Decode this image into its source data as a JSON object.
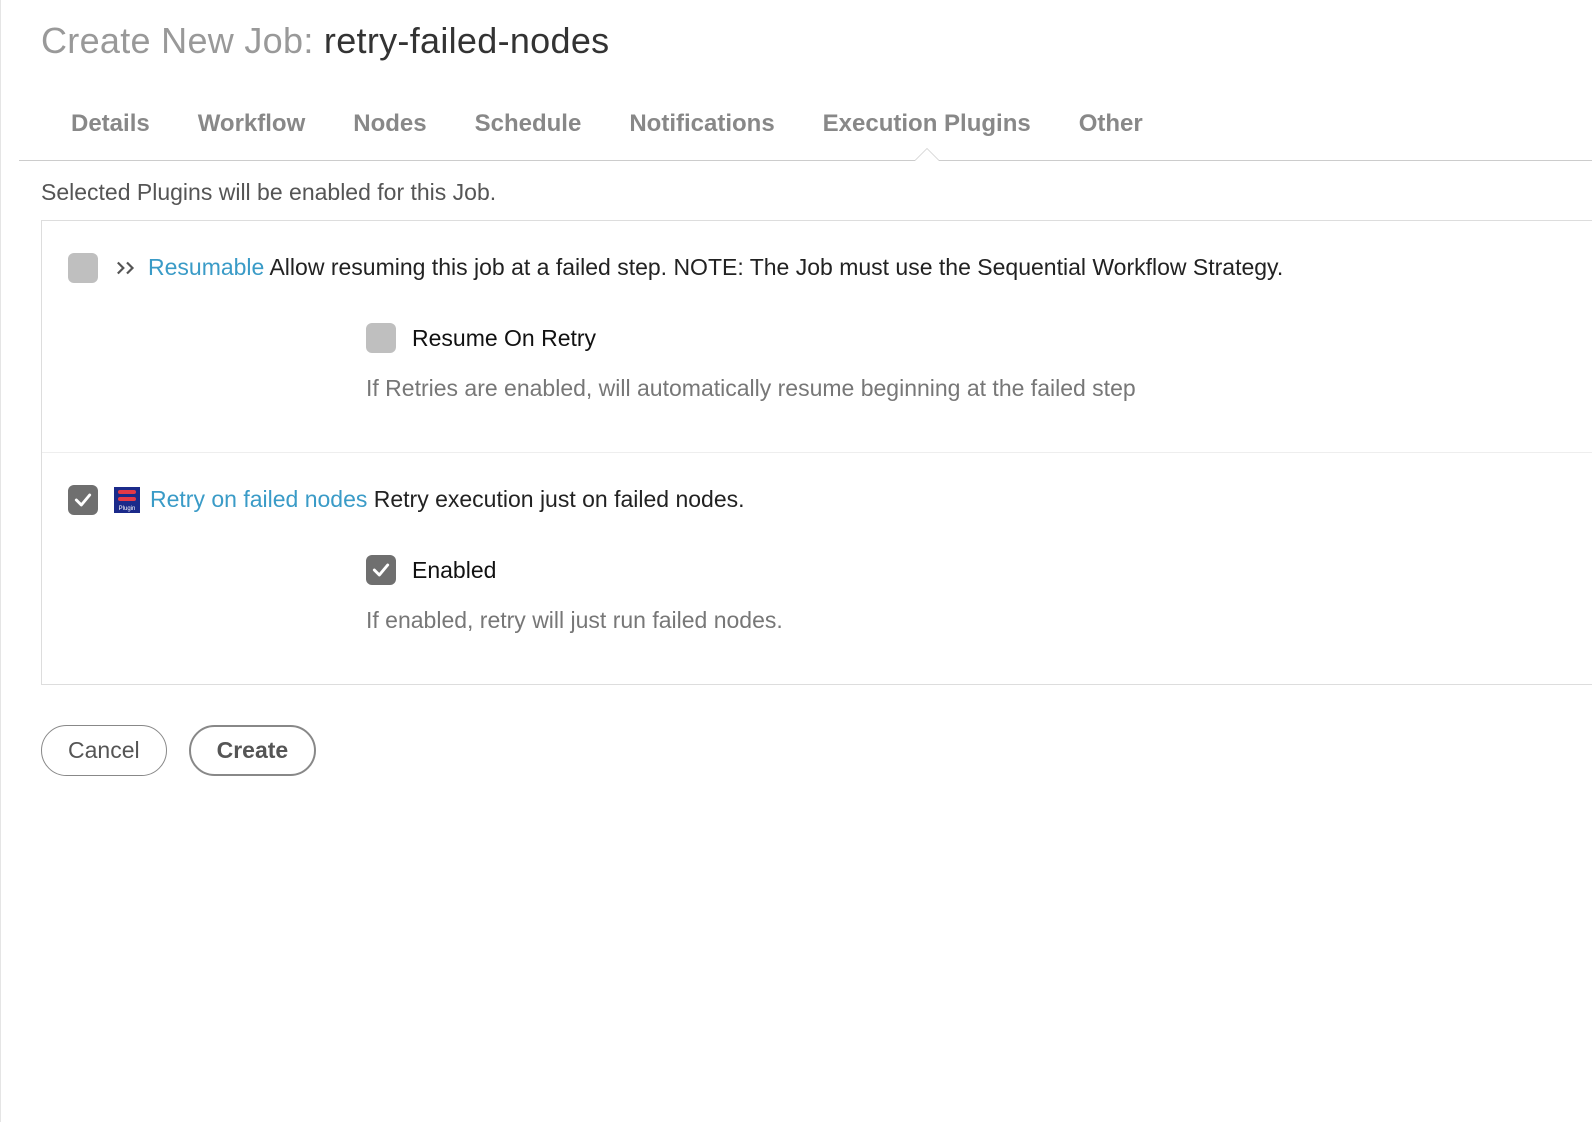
{
  "title": {
    "prefix": "Create New Job: ",
    "name": "retry-failed-nodes"
  },
  "tabs": {
    "details": "Details",
    "workflow": "Workflow",
    "nodes": "Nodes",
    "schedule": "Schedule",
    "notifications": "Notifications",
    "execution_plugins": "Execution Plugins",
    "other": "Other",
    "active": "execution_plugins"
  },
  "subheading": "Selected Plugins will be enabled for this Job.",
  "plugins": {
    "resumable": {
      "checked": false,
      "link_label": "Resumable",
      "description": "Allow resuming this job at a failed step. NOTE: The Job must use the Sequential Workflow Strategy.",
      "option": {
        "checked": false,
        "label": "Resume On Retry",
        "help": "If Retries are enabled, will automatically resume beginning at the failed step"
      }
    },
    "retry_failed_nodes": {
      "checked": true,
      "icon_label": "Plugin",
      "link_label": "Retry on failed nodes",
      "description": "Retry execution just on failed nodes.",
      "option": {
        "checked": true,
        "label": "Enabled",
        "help": "If enabled, retry will just run failed nodes."
      }
    }
  },
  "buttons": {
    "cancel": "Cancel",
    "create": "Create"
  }
}
